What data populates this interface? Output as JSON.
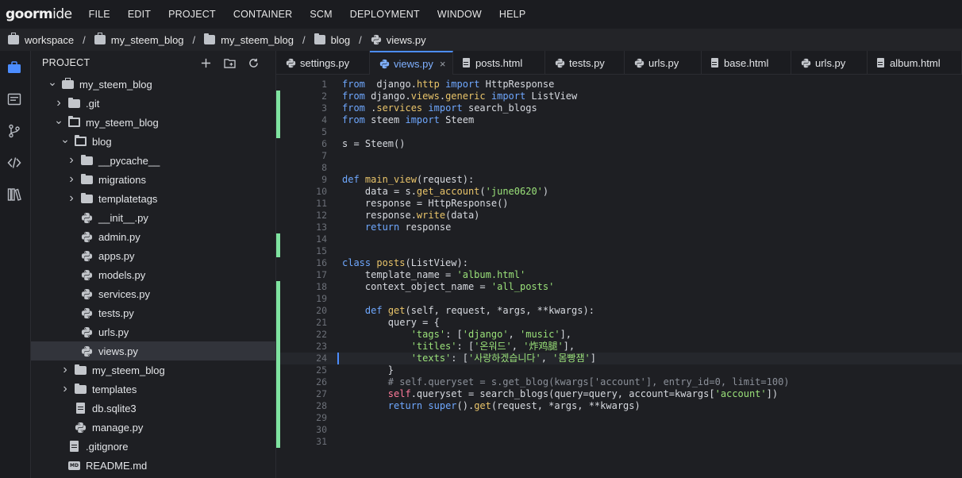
{
  "menubar": {
    "logo_bold": "goorm",
    "logo_thin": "ide",
    "items": [
      "FILE",
      "EDIT",
      "PROJECT",
      "CONTAINER",
      "SCM",
      "DEPLOYMENT",
      "WINDOW",
      "HELP"
    ]
  },
  "breadcrumb": [
    "workspace",
    "my_steem_blog",
    "my_steem_blog",
    "blog",
    "views.py"
  ],
  "project_panel": {
    "title": "PROJECT",
    "tree": [
      {
        "label": "my_steem_blog",
        "type": "case",
        "level": 0,
        "state": "open"
      },
      {
        "label": ".git",
        "type": "folder",
        "level": 1,
        "state": "closed"
      },
      {
        "label": "my_steem_blog",
        "type": "folder-open",
        "level": 1,
        "state": "open"
      },
      {
        "label": "blog",
        "type": "folder-open",
        "level": 2,
        "state": "open"
      },
      {
        "label": "__pycache__",
        "type": "folder",
        "level": 3,
        "state": "closed"
      },
      {
        "label": "migrations",
        "type": "folder",
        "level": 3,
        "state": "closed"
      },
      {
        "label": "templatetags",
        "type": "folder",
        "level": 3,
        "state": "closed"
      },
      {
        "label": "__init__.py",
        "type": "python",
        "level": 3,
        "state": "none"
      },
      {
        "label": "admin.py",
        "type": "python",
        "level": 3,
        "state": "none"
      },
      {
        "label": "apps.py",
        "type": "python",
        "level": 3,
        "state": "none"
      },
      {
        "label": "models.py",
        "type": "python",
        "level": 3,
        "state": "none"
      },
      {
        "label": "services.py",
        "type": "python",
        "level": 3,
        "state": "none"
      },
      {
        "label": "tests.py",
        "type": "python",
        "level": 3,
        "state": "none"
      },
      {
        "label": "urls.py",
        "type": "python",
        "level": 3,
        "state": "none"
      },
      {
        "label": "views.py",
        "type": "python",
        "level": 3,
        "state": "selected"
      },
      {
        "label": "my_steem_blog",
        "type": "folder",
        "level": 2,
        "state": "closed"
      },
      {
        "label": "templates",
        "type": "folder",
        "level": 2,
        "state": "closed"
      },
      {
        "label": "db.sqlite3",
        "type": "file",
        "level": 2,
        "state": "none"
      },
      {
        "label": "manage.py",
        "type": "python",
        "level": 2,
        "state": "none"
      },
      {
        "label": ".gitignore",
        "type": "file",
        "level": 1,
        "state": "none"
      },
      {
        "label": "README.md",
        "type": "md",
        "level": 1,
        "state": "none"
      }
    ]
  },
  "tabs": [
    {
      "label": "settings.py",
      "icon": "python",
      "active": false
    },
    {
      "label": "views.py",
      "icon": "python",
      "active": true
    },
    {
      "label": "posts.html",
      "icon": "file",
      "active": false
    },
    {
      "label": "tests.py",
      "icon": "python",
      "active": false
    },
    {
      "label": "urls.py",
      "icon": "python",
      "active": false
    },
    {
      "label": "base.html",
      "icon": "file",
      "active": false
    },
    {
      "label": "urls.py",
      "icon": "python",
      "active": false
    },
    {
      "label": "album.html",
      "icon": "file",
      "active": false
    }
  ],
  "editor": {
    "current_line": 24,
    "modified_lines": [
      2,
      3,
      4,
      5,
      14,
      15,
      18,
      19,
      20,
      21,
      22,
      23,
      24,
      25,
      26,
      27,
      28,
      29,
      30,
      31
    ],
    "lines": [
      [
        [
          "kw",
          "from"
        ],
        [
          "",
          "  django."
        ],
        [
          "mod",
          "http"
        ],
        [
          "",
          " "
        ],
        [
          "kw",
          "import"
        ],
        [
          "",
          " HttpResponse"
        ]
      ],
      [
        [
          "kw",
          "from"
        ],
        [
          "",
          " django."
        ],
        [
          "mod",
          "views"
        ],
        [
          "",
          "."
        ],
        [
          "mod",
          "generic"
        ],
        [
          "",
          " "
        ],
        [
          "kw",
          "import"
        ],
        [
          "",
          " ListView"
        ]
      ],
      [
        [
          "kw",
          "from"
        ],
        [
          "",
          " ."
        ],
        [
          "mod",
          "services"
        ],
        [
          "",
          " "
        ],
        [
          "kw",
          "import"
        ],
        [
          "",
          " search_blogs"
        ]
      ],
      [
        [
          "kw",
          "from"
        ],
        [
          "",
          " steem "
        ],
        [
          "kw",
          "import"
        ],
        [
          "",
          " Steem"
        ]
      ],
      [],
      [
        [
          "",
          "s = Steem()"
        ]
      ],
      [],
      [],
      [
        [
          "kw",
          "def"
        ],
        [
          "",
          " "
        ],
        [
          "fn",
          "main_view"
        ],
        [
          "",
          "(request):"
        ]
      ],
      [
        [
          "",
          "    data = s."
        ],
        [
          "fn",
          "get_account"
        ],
        [
          "",
          "("
        ],
        [
          "str",
          "'june0620'"
        ],
        [
          "",
          ")"
        ]
      ],
      [
        [
          "",
          "    response = HttpResponse()"
        ]
      ],
      [
        [
          "",
          "    response."
        ],
        [
          "fn",
          "write"
        ],
        [
          "",
          "(data)"
        ]
      ],
      [
        [
          "",
          "    "
        ],
        [
          "kw",
          "return"
        ],
        [
          "",
          " response"
        ]
      ],
      [],
      [],
      [
        [
          "kw",
          "class"
        ],
        [
          "",
          " "
        ],
        [
          "fn",
          "posts"
        ],
        [
          "",
          "(ListView):"
        ]
      ],
      [
        [
          "",
          "    template_name = "
        ],
        [
          "str",
          "'album.html'"
        ]
      ],
      [
        [
          "",
          "    context_object_name = "
        ],
        [
          "str",
          "'all_posts'"
        ]
      ],
      [],
      [
        [
          "",
          "    "
        ],
        [
          "kw",
          "def"
        ],
        [
          "",
          " "
        ],
        [
          "fn",
          "get"
        ],
        [
          "",
          "(self, request, *args, **kwargs):"
        ]
      ],
      [
        [
          "",
          "        query = {"
        ]
      ],
      [
        [
          "",
          "            "
        ],
        [
          "str",
          "'tags'"
        ],
        [
          "",
          ": ["
        ],
        [
          "str",
          "'django'"
        ],
        [
          "",
          ", "
        ],
        [
          "str",
          "'music'"
        ],
        [
          "",
          "],"
        ]
      ],
      [
        [
          "",
          "            "
        ],
        [
          "str",
          "'titles'"
        ],
        [
          "",
          ": ["
        ],
        [
          "str",
          "'온워드'"
        ],
        [
          "",
          ", "
        ],
        [
          "str",
          "'炸鸡腿'"
        ],
        [
          "",
          "],"
        ]
      ],
      [
        [
          "",
          "            "
        ],
        [
          "str",
          "'texts'"
        ],
        [
          "",
          ": ["
        ],
        [
          "str",
          "'사랑하겠습니다'"
        ],
        [
          "",
          ", "
        ],
        [
          "str",
          "'몸빵잼'"
        ],
        [
          "",
          "]"
        ]
      ],
      [
        [
          "",
          "        }"
        ]
      ],
      [
        [
          "",
          "        "
        ],
        [
          "cmt",
          "# self.queryset = s.get_blog(kwargs['account'], entry_id=0, limit=100)"
        ]
      ],
      [
        [
          "",
          "        "
        ],
        [
          "self",
          "self"
        ],
        [
          "",
          ".queryset = search_blogs(query=query, account=kwargs["
        ],
        [
          "str",
          "'account'"
        ],
        [
          "",
          "])"
        ]
      ],
      [
        [
          "",
          "        "
        ],
        [
          "kw",
          "return"
        ],
        [
          "",
          " "
        ],
        [
          "kw",
          "super"
        ],
        [
          "",
          "()."
        ],
        [
          "fn",
          "get"
        ],
        [
          "",
          "(request, *args, **kwargs)"
        ]
      ],
      [],
      [],
      []
    ]
  }
}
